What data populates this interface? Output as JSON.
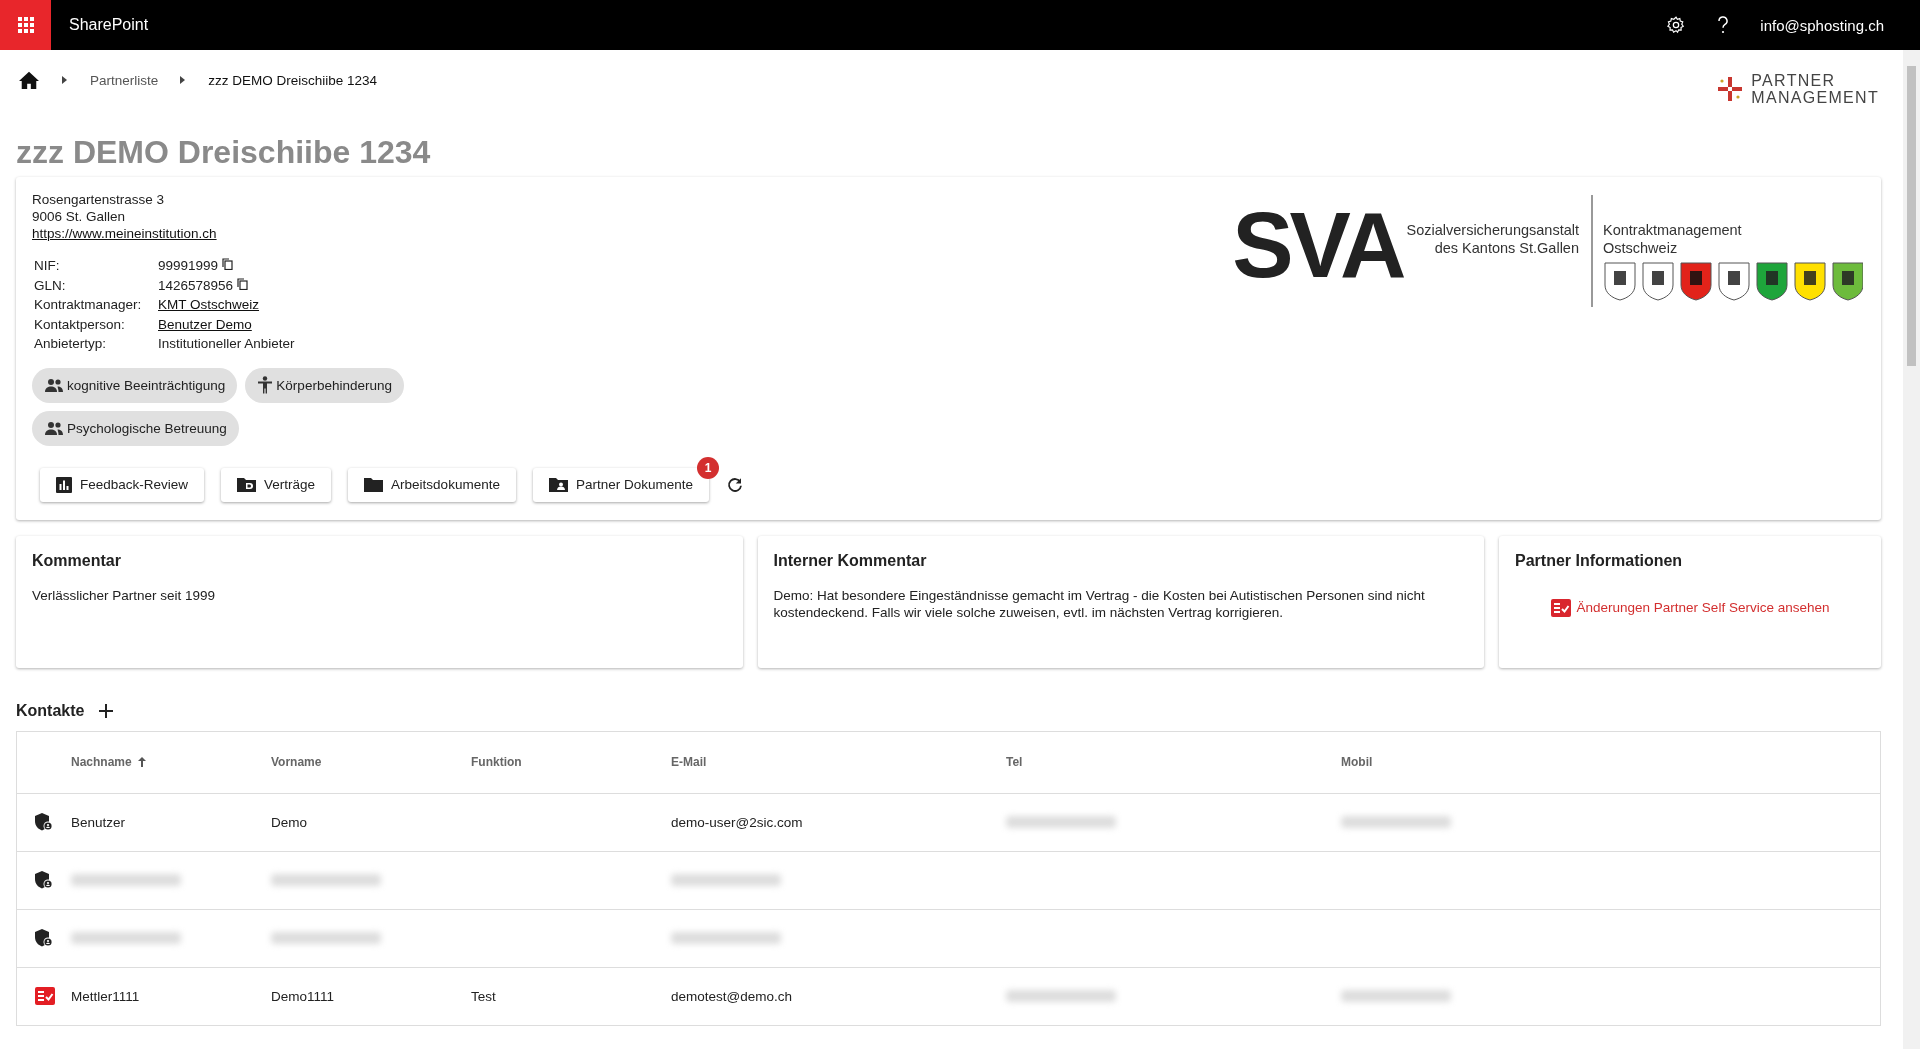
{
  "topbar": {
    "app_name": "SharePoint",
    "user": "info@sphosting.ch"
  },
  "breadcrumb": [
    "Partnerliste",
    "zzz DEMO Dreischiibe 1234"
  ],
  "brand_logo": {
    "line_1": "PARTNER",
    "line_2": "MANAGEMENT"
  },
  "title": "zzz DEMO Dreischiibe 1234",
  "address": {
    "street": "Rosengartenstrasse 3",
    "city": "9006 St. Gallen",
    "website": "https://www.meineinstitution.ch"
  },
  "details": [
    {
      "label": "NIF:",
      "value": "99991999",
      "kind": "copy"
    },
    {
      "label": "GLN:",
      "value": "1426578956",
      "kind": "copy"
    },
    {
      "label": "Kontraktmanager:",
      "value": "KMT Ostschweiz",
      "kind": "link"
    },
    {
      "label": "Kontaktperson:",
      "value": "Benutzer Demo",
      "kind": "link"
    },
    {
      "label": "Anbietertyp:",
      "value": "Institutioneller Anbieter",
      "kind": "text"
    }
  ],
  "tags": [
    {
      "label": "kognitive Beeinträchtigung",
      "kind": "group"
    },
    {
      "label": "Körperbehinderung",
      "kind": "person"
    },
    {
      "label": "Psychologische Betreuung",
      "kind": "group"
    }
  ],
  "sva_logo": {
    "letters": "SVA",
    "name_1": "Sozialversicherungsanstalt",
    "name_2": "des Kantons St.Gallen",
    "unit_1": "Kontraktmanagement",
    "unit_2": "Ostschweiz"
  },
  "actions": [
    {
      "label": "Feedback-Review",
      "kind": "chart"
    },
    {
      "label": "Verträge",
      "kind": "contract"
    },
    {
      "label": "Arbeitsdokumente",
      "kind": "folder"
    },
    {
      "label": "Partner Dokumente",
      "kind": "shared",
      "badge": "1"
    }
  ],
  "cards": [
    {
      "title": "Kommentar",
      "text": "Verlässlicher Partner seit 1999",
      "kind": "text"
    },
    {
      "title": "Interner Kommentar",
      "text": "Demo: Hat besondere Eingeständnisse gemacht im Vertrag - die Kosten bei Autistischen Personen sind nicht kostendeckend. Falls wir viele solche zuweisen, evtl. im nächsten Vertrag korrigieren.",
      "kind": "text"
    },
    {
      "title": "Partner Informationen",
      "text": "Änderungen Partner Self Service ansehen",
      "kind": "link"
    }
  ],
  "contacts": {
    "title": "Kontakte",
    "columns": [
      {
        "label": "Nachname",
        "sorted": true
      },
      {
        "label": "Vorname",
        "sorted": false
      },
      {
        "label": "Funktion",
        "sorted": false
      },
      {
        "label": "E-Mail",
        "sorted": false
      },
      {
        "label": "Tel",
        "sorted": false
      },
      {
        "label": "Mobil",
        "sorted": false
      }
    ],
    "rows": [
      {
        "kind": "user",
        "cells": [
          {
            "text": "Benutzer"
          },
          {
            "text": "Demo"
          },
          null,
          {
            "text": "demo-user@2sic.com"
          },
          {
            "redacted": true
          },
          {
            "redacted": true
          }
        ]
      },
      {
        "kind": "user",
        "cells": [
          {
            "redacted": true
          },
          {
            "redacted": true
          },
          null,
          {
            "redacted": true
          },
          null,
          null
        ]
      },
      {
        "kind": "user",
        "cells": [
          {
            "redacted": true
          },
          {
            "redacted": true
          },
          null,
          {
            "redacted": true
          },
          null,
          null
        ]
      },
      {
        "kind": "selfservice",
        "cells": [
          {
            "text": "Mettler1111"
          },
          {
            "text": "Demo1111"
          },
          {
            "text": "Test"
          },
          {
            "text": "demotest@demo.ch"
          },
          {
            "redacted": true
          },
          {
            "redacted": true
          }
        ]
      }
    ]
  }
}
